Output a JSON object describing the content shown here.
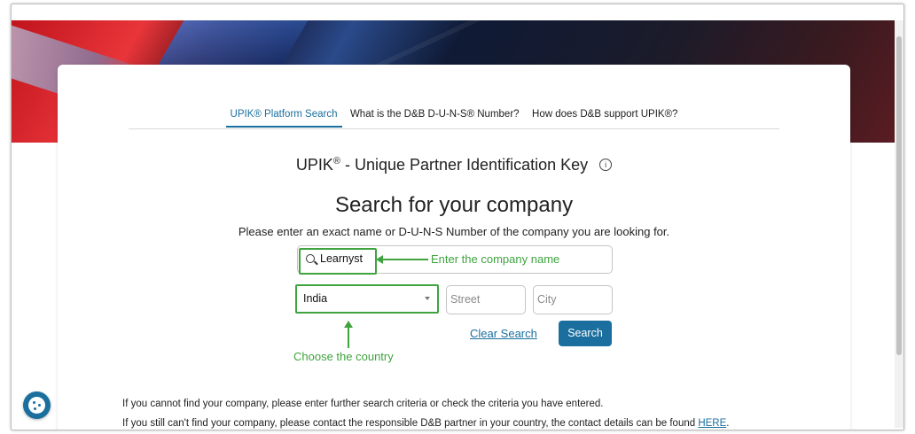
{
  "tabs": [
    {
      "label": "UPIK® Platform Search",
      "active": true
    },
    {
      "label": "What is the D&B D-U-N-S® Number?",
      "active": false
    },
    {
      "label": "How does D&B support UPIK®?",
      "active": false
    }
  ],
  "heading": {
    "brand": "UPIK",
    "sup": "®",
    "rest": " - Unique Partner Identification Key",
    "info_icon": "i"
  },
  "title": "Search for your company",
  "subtitle": "Please enter an exact name or D-U-N-S Number of the company you are looking for.",
  "search": {
    "value": "Learnyst",
    "icon": "search-icon"
  },
  "country": {
    "selected": "India"
  },
  "street": {
    "placeholder": "Street"
  },
  "city": {
    "placeholder": "City"
  },
  "annotations": {
    "name": "Enter the company name",
    "country": "Choose the country",
    "color": "#3fa33f"
  },
  "actions": {
    "clear": "Clear Search",
    "search": "Search"
  },
  "notes": {
    "line1": "If you cannot find your company, please enter further search criteria or check the criteria you have entered.",
    "line2_prefix": "If you still can't find your company, please contact the responsible D&B partner in your country, the contact details can be found ",
    "link": "HERE",
    "line2_suffix": "."
  },
  "colors": {
    "accent": "#1a6f9e",
    "annotation": "#3fa33f"
  },
  "cookie_icon": "cookie-icon"
}
